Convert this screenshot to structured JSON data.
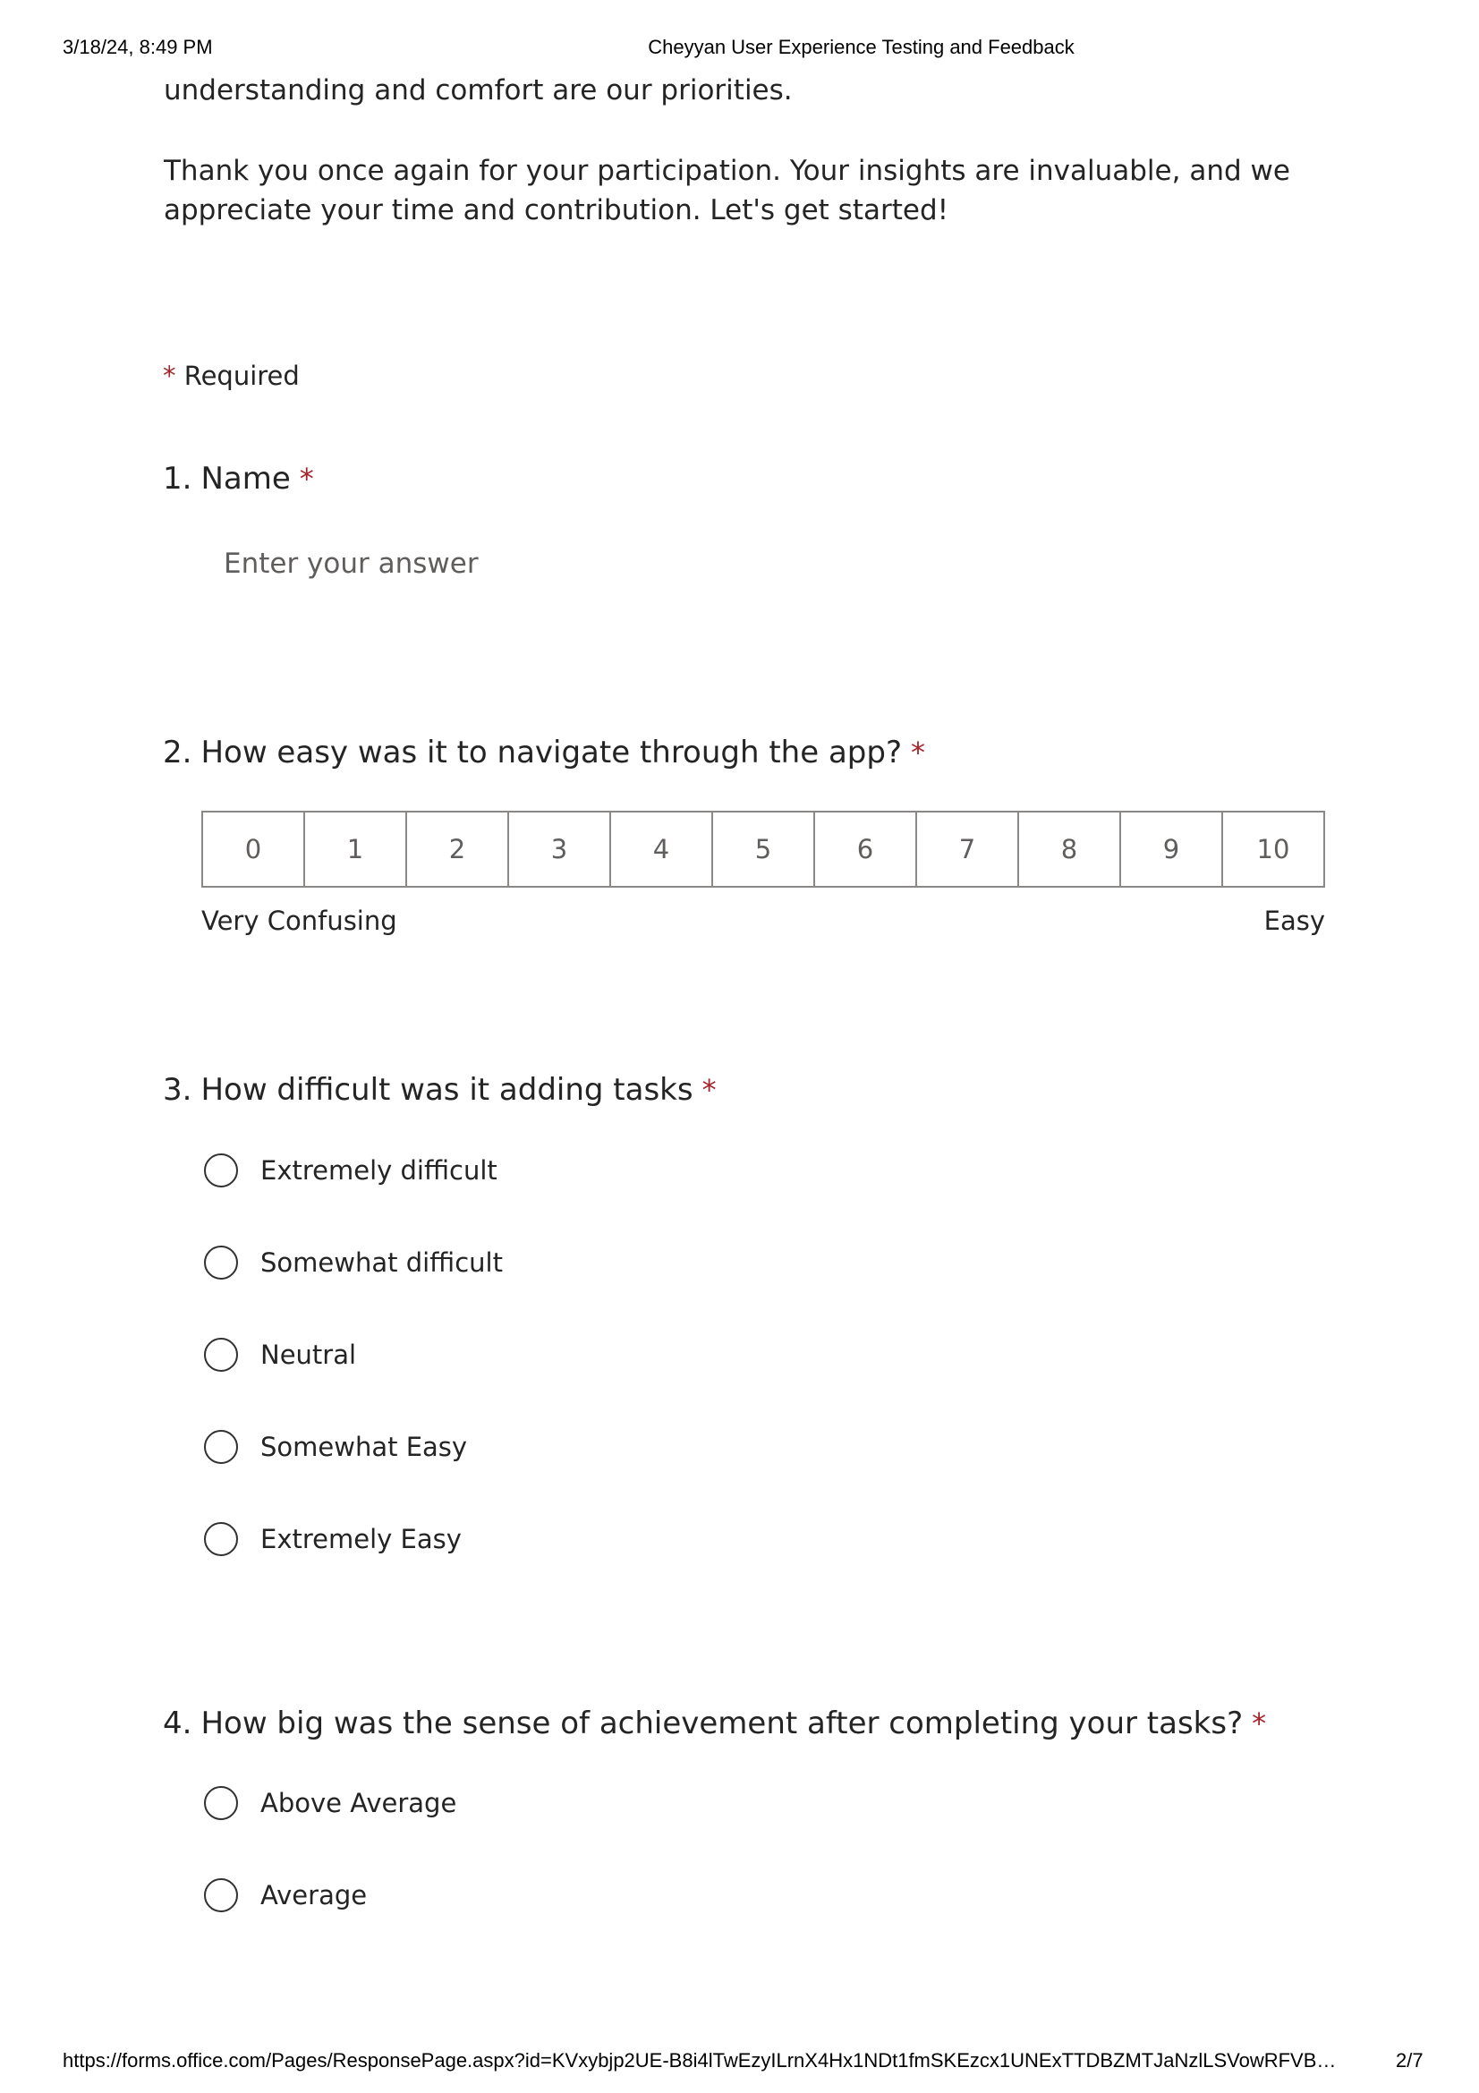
{
  "print_header": {
    "date": "3/18/24, 8:49 PM",
    "title": "Cheyyan User Experience Testing and Feedback"
  },
  "print_footer": {
    "url": "https://forms.office.com/Pages/ResponsePage.aspx?id=KVxybjp2UE-B8i4lTwEzyILrnX4Hx1NDt1fmSKEzcx1UNExTTDBZMTJaNzlLSVowRFVB…",
    "page": "2/7"
  },
  "intro": {
    "line1": "understanding and comfort are our priorities.",
    "para2": "Thank you once again for your participation. Your insights are invaluable, and we appreciate your time and contribution. Let's get started!"
  },
  "required_note": {
    "asterisk": "*",
    "label": "Required"
  },
  "questions": [
    {
      "number": "1.",
      "title": "Name",
      "asterisk": "*",
      "placeholder": "Enter your answer"
    },
    {
      "number": "2.",
      "title": "How easy was it to navigate through the app?",
      "asterisk": "*",
      "scale": [
        "0",
        "1",
        "2",
        "3",
        "4",
        "5",
        "6",
        "7",
        "8",
        "9",
        "10"
      ],
      "min_label": "Very Confusing",
      "max_label": "Easy"
    },
    {
      "number": "3.",
      "title": "How difficult was it adding tasks",
      "asterisk": "*",
      "options": [
        "Extremely difficult",
        "Somewhat difficult",
        "Neutral",
        "Somewhat Easy",
        "Extremely Easy"
      ]
    },
    {
      "number": "4.",
      "title": "How big was the sense of achievement after completing your tasks?",
      "asterisk": "*",
      "options": [
        "Above Average",
        "Average"
      ]
    }
  ],
  "colors": {
    "required_asterisk": "#a4262c",
    "text": "#242424",
    "muted": "#605e5c",
    "border": "#8a8886"
  }
}
